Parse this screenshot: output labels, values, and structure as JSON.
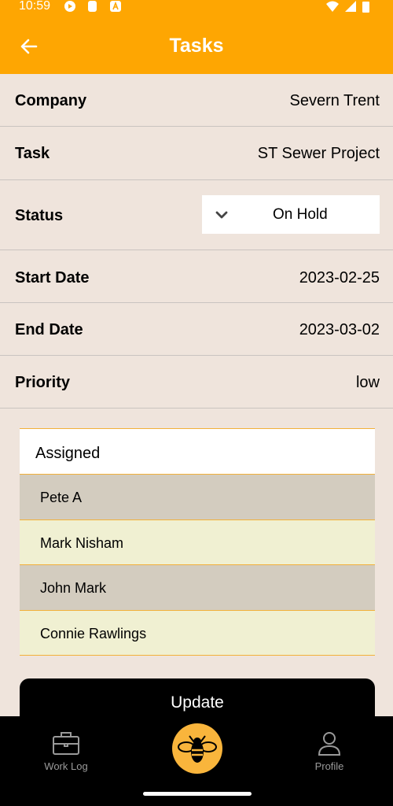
{
  "status_bar": {
    "time": "10:59"
  },
  "header": {
    "title": "Tasks"
  },
  "details": [
    {
      "label": "Company",
      "value": "Severn Trent"
    },
    {
      "label": "Task",
      "value": "ST Sewer Project"
    },
    {
      "label": "Status",
      "value": "On Hold"
    },
    {
      "label": "Start Date",
      "value": "2023-02-25"
    },
    {
      "label": "End Date",
      "value": "2023-03-02"
    },
    {
      "label": "Priority",
      "value": "low"
    }
  ],
  "assigned": {
    "title": "Assigned",
    "people": [
      "Pete A",
      "Mark Nisham",
      "John Mark",
      "Connie Rawlings"
    ]
  },
  "update_label": "Update",
  "nav": {
    "worklog": "Work Log",
    "profile": "Profile"
  },
  "colors": {
    "accent": "#fea602",
    "background": "#efe4dc",
    "row_a": "#d3ccbf",
    "row_b": "#f0f0d2"
  }
}
